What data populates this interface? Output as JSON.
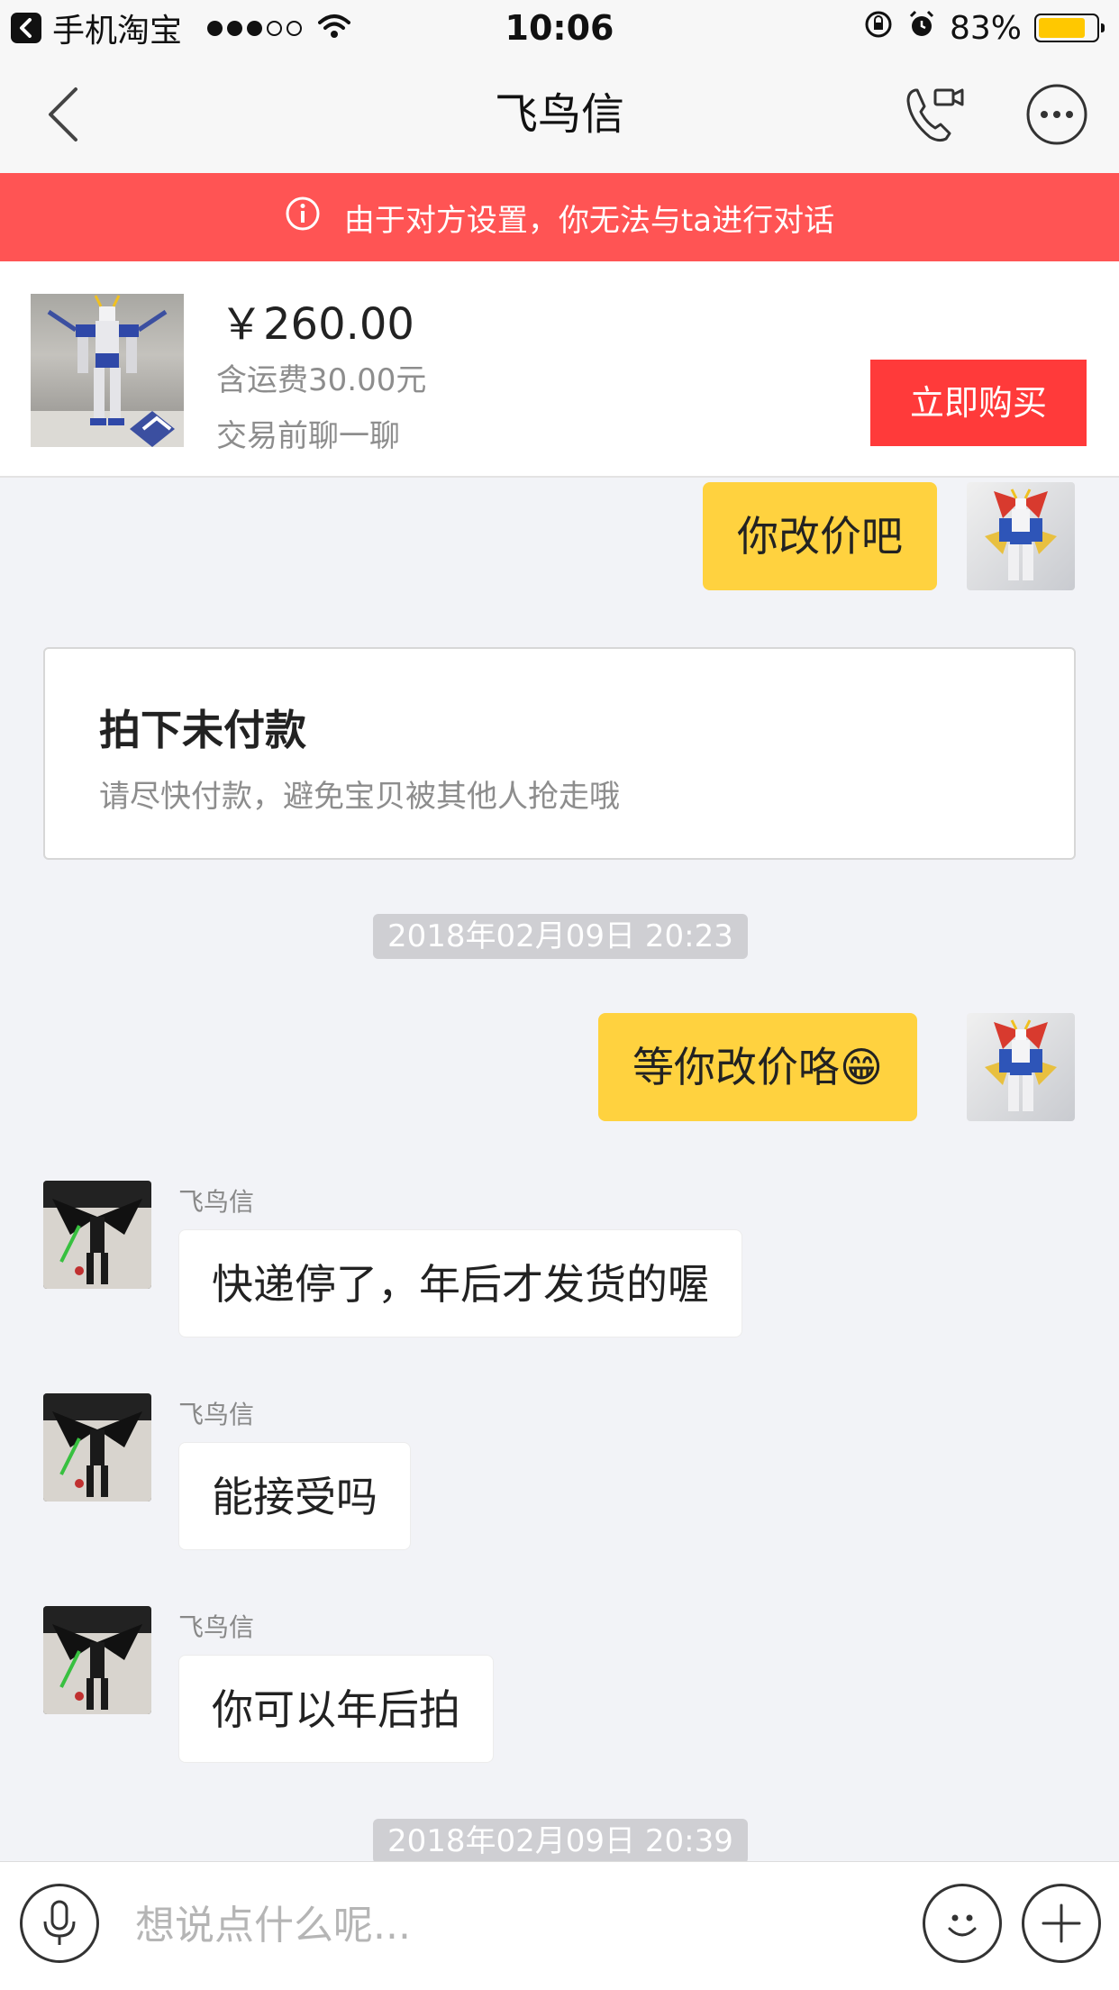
{
  "status_bar": {
    "back_app_label": "手机淘宝",
    "time": "10:06",
    "battery_percent": "83%",
    "battery_level": 0.83,
    "signal_filled": 3,
    "signal_total": 5,
    "icons": [
      "back-arrow-icon",
      "wifi-icon",
      "rotation-lock-icon",
      "alarm-icon",
      "battery-icon"
    ]
  },
  "nav": {
    "title": "飞鸟信",
    "icons": [
      "back-chevron-icon",
      "video-call-icon",
      "more-icon"
    ]
  },
  "warning": {
    "icon": "info-icon",
    "text": "由于对方设置，你无法与ta进行对话"
  },
  "product": {
    "price": "￥260.00",
    "shipping": "含运费30.00元",
    "chat_prompt": "交易前聊一聊",
    "buy_label": "立即购买"
  },
  "chat": {
    "messages": [
      {
        "from": "me",
        "text": "你改价吧"
      },
      {
        "type": "order-card",
        "title": "拍下未付款",
        "desc": "请尽快付款，避免宝贝被其他人抢走哦"
      },
      {
        "type": "timestamp",
        "text": "2018年02月09日  20:23"
      },
      {
        "from": "me",
        "text": "等你改价咯",
        "emoji": "😁"
      },
      {
        "from": "other",
        "sender": "飞鸟信",
        "text": "快递停了，年后才发货的喔"
      },
      {
        "from": "other",
        "sender": "飞鸟信",
        "text": "能接受吗"
      },
      {
        "from": "other",
        "sender": "飞鸟信",
        "text": "你可以年后拍"
      },
      {
        "type": "timestamp",
        "text": "2018年02月09日  20:39"
      }
    ]
  },
  "input_bar": {
    "placeholder": "想说点什么呢...",
    "value": "",
    "icons": [
      "microphone-icon",
      "emoji-icon",
      "plus-icon"
    ]
  },
  "colors": {
    "warning_bg": "#ff5454",
    "buy_button": "#ff3a3a",
    "my_bubble": "#ffd23f",
    "chat_bg": "#f2f3f7",
    "battery_fill": "#ffc800"
  }
}
